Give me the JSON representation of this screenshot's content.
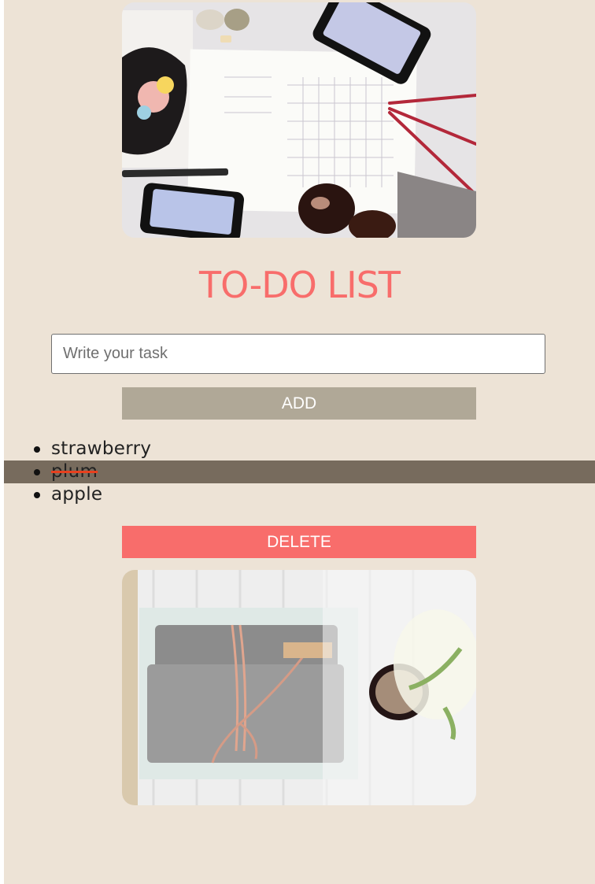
{
  "header": {
    "title": "TO-DO LIST"
  },
  "input": {
    "placeholder": "Write your task",
    "value": ""
  },
  "buttons": {
    "add_label": "ADD",
    "delete_label": "DELETE"
  },
  "tasks": [
    {
      "text": "strawberry",
      "done": false,
      "selected": false
    },
    {
      "text": "plum",
      "done": true,
      "selected": true
    },
    {
      "text": "apple",
      "done": false,
      "selected": false
    }
  ],
  "colors": {
    "background": "#ede3d6",
    "accent": "#f86d6b",
    "add_button": "#b0a897",
    "selected_row": "#776b5d",
    "strike": "#e8401e"
  }
}
